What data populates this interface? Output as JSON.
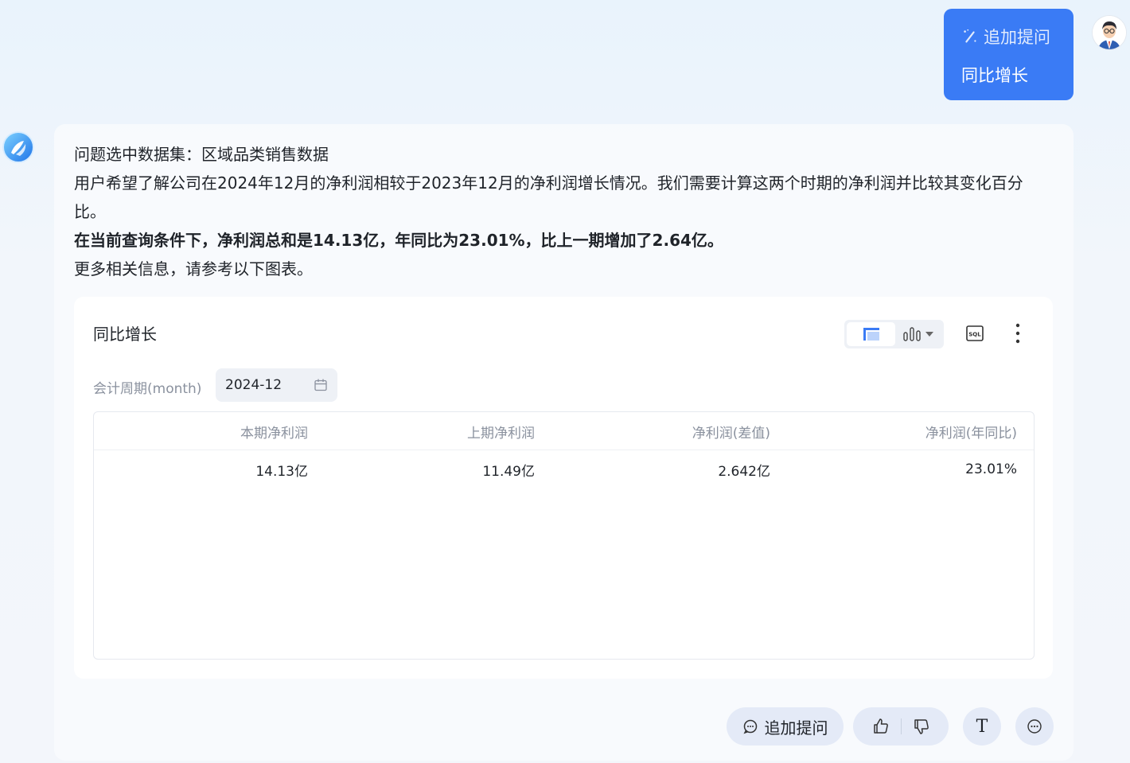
{
  "user_message": {
    "followup_tag": "追加提问",
    "text": "同比增长"
  },
  "answer": {
    "line1": "问题选中数据集：区域品类销售数据",
    "line2": "用户希望了解公司在2024年12月的净利润相较于2023年12月的净利润增长情况。我们需要计算这两个时期的净利润并比较其变化百分比。",
    "line3_bold": "在当前查询条件下，净利润总和是14.13亿，年同比为23.01%，比上一期增加了2.64亿。",
    "line4": "更多相关信息，请参考以下图表。"
  },
  "result_card": {
    "title": "同比增长",
    "sql_label": "SQL",
    "filter_label": "会计周期(month)",
    "filter_value": "2024-12",
    "table": {
      "headers": [
        "本期净利润",
        "上期净利润",
        "净利润(差值)",
        "净利润(年同比)"
      ],
      "rows": [
        [
          "14.13亿",
          "11.49亿",
          "2.642亿",
          "23.01%"
        ]
      ]
    }
  },
  "actions": {
    "followup_label": "追加提问",
    "text_button_label": "T"
  },
  "colors": {
    "accent": "#3a7bf5",
    "pill_bg": "#e4eaf7"
  }
}
